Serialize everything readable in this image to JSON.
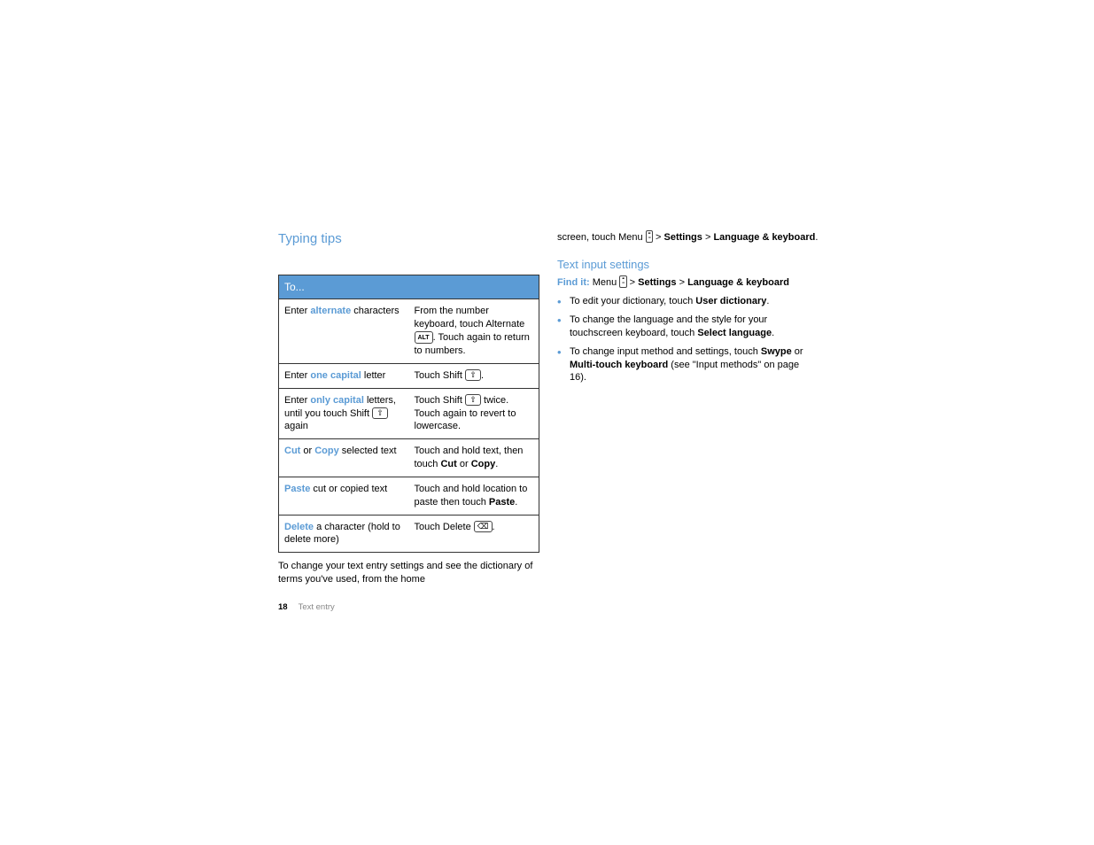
{
  "leftCol": {
    "heading": "Typing tips",
    "tableHeader": "To...",
    "rows": [
      {
        "left_pre": "Enter ",
        "left_kw": "alternate",
        "left_post": " characters",
        "right_pre": "From the number keyboard, touch Alternate ",
        "right_icon": "alt",
        "right_mid": ". Touch again to return to numbers."
      },
      {
        "left_pre": "Enter ",
        "left_kw": "one capital",
        "left_post": " letter",
        "right_pre": "Touch Shift ",
        "right_icon": "shift",
        "right_mid": "."
      },
      {
        "left_pre": "Enter ",
        "left_kw": "only capital",
        "left_post": " letters, until you touch Shift ",
        "left_icon": "shift",
        "left_tail": " again",
        "right_pre": "Touch Shift ",
        "right_icon": "shift",
        "right_mid": " twice. Touch again to revert to lowercase."
      },
      {
        "left_kw": "Cut",
        "left_join": " or ",
        "left_kw2": "Copy",
        "left_post": " selected text",
        "right_pre": "Touch and hold text, then touch ",
        "right_bold": "Cut",
        "right_mid": " or ",
        "right_bold2": "Copy",
        "right_tail": "."
      },
      {
        "left_kw": "Paste",
        "left_post": " cut or copied text",
        "right_pre": "Touch and hold location to paste then touch ",
        "right_bold": "Paste",
        "right_tail": "."
      },
      {
        "left_kw": "Delete",
        "left_post": " a character (hold to delete more)",
        "right_pre": "Touch Delete ",
        "right_icon": "del",
        "right_mid": "."
      }
    ],
    "afterTable": "To change your text entry settings and see the dictionary of terms you've used, from the home"
  },
  "rightCol": {
    "continuation_pre": "screen, touch Menu ",
    "continuation_mid": " > ",
    "continuation_b1": "Settings",
    "continuation_mid2": " > ",
    "continuation_b2": "Language & keyboard",
    "continuation_tail": ".",
    "heading": "Text input settings",
    "findit_label": "Find it:",
    "findit_pre": " Menu ",
    "findit_mid": " > ",
    "findit_b1": "Settings",
    "findit_mid2": " > ",
    "findit_b2": "Language & keyboard",
    "bullets": [
      {
        "pre": "To edit your dictionary, touch ",
        "b1": "User dictionary",
        "tail": "."
      },
      {
        "pre": "To change the language and the style for your touchscreen keyboard, touch ",
        "b1": "Select language",
        "tail": "."
      },
      {
        "pre": "To change input method and settings, touch ",
        "b1": "Swype",
        "mid": " or ",
        "b2": "Multi-touch keyboard",
        "tail": " (see \"Input methods\" on page 16)."
      }
    ]
  },
  "footer": {
    "page": "18",
    "section": "Text entry"
  }
}
